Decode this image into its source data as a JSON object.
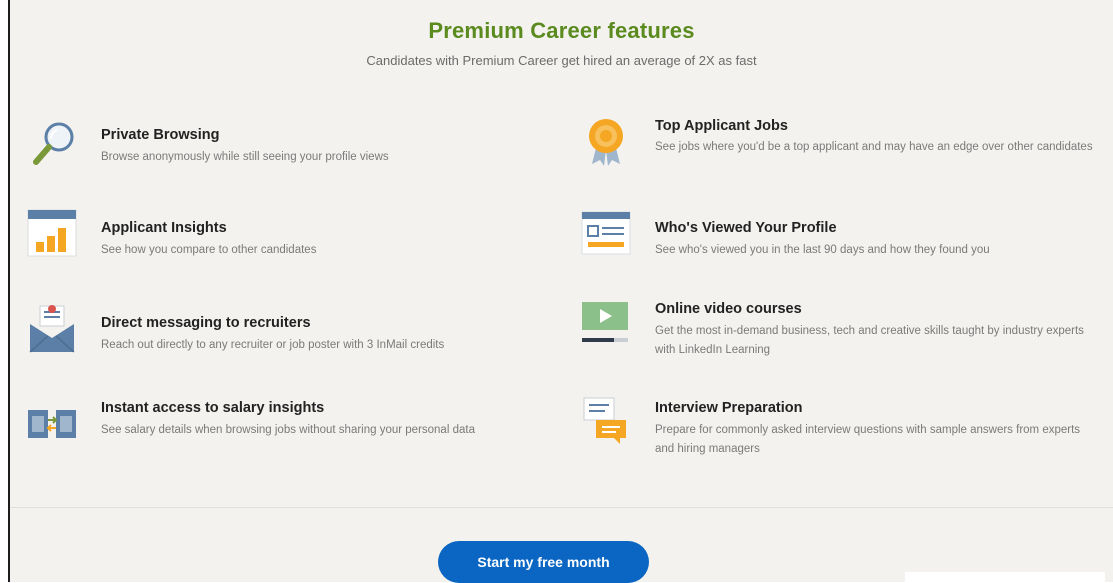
{
  "header": {
    "title": "Premium Career features",
    "subtitle": "Candidates with Premium Career get hired an average of 2X as fast"
  },
  "features_left": [
    {
      "icon": "magnifier-icon",
      "title": "Private Browsing",
      "description": "Browse anonymously while still seeing your profile views"
    },
    {
      "icon": "bar-chart-icon",
      "title": "Applicant Insights",
      "description": "See how you compare to other candidates"
    },
    {
      "icon": "envelope-icon",
      "title": "Direct messaging to recruiters",
      "description": "Reach out directly to any recruiter or job poster with 3 InMail credits"
    },
    {
      "icon": "salary-compare-icon",
      "title": "Instant access to salary insights",
      "description": "See salary details when browsing jobs without sharing your personal data"
    }
  ],
  "features_right": [
    {
      "icon": "badge-icon",
      "title": "Top Applicant Jobs",
      "description": "See jobs where you'd be a top applicant and may have an edge over other candidates"
    },
    {
      "icon": "profile-card-icon",
      "title": "Who's Viewed Your Profile",
      "description": "See who's viewed you in the last 90 days and how they found you"
    },
    {
      "icon": "video-icon",
      "title": "Online video courses",
      "description": "Get the most in-demand business, tech and creative skills taught by industry experts with LinkedIn Learning"
    },
    {
      "icon": "chat-bubbles-icon",
      "title": "Interview Preparation",
      "description": "Prepare for commonly asked interview questions with sample answers from experts and hiring managers"
    }
  ],
  "cta": {
    "label": "Start my free month"
  },
  "colors": {
    "title_green": "#5b8a1e",
    "cta_blue": "#0a66c2",
    "background": "#f3f2ef"
  }
}
